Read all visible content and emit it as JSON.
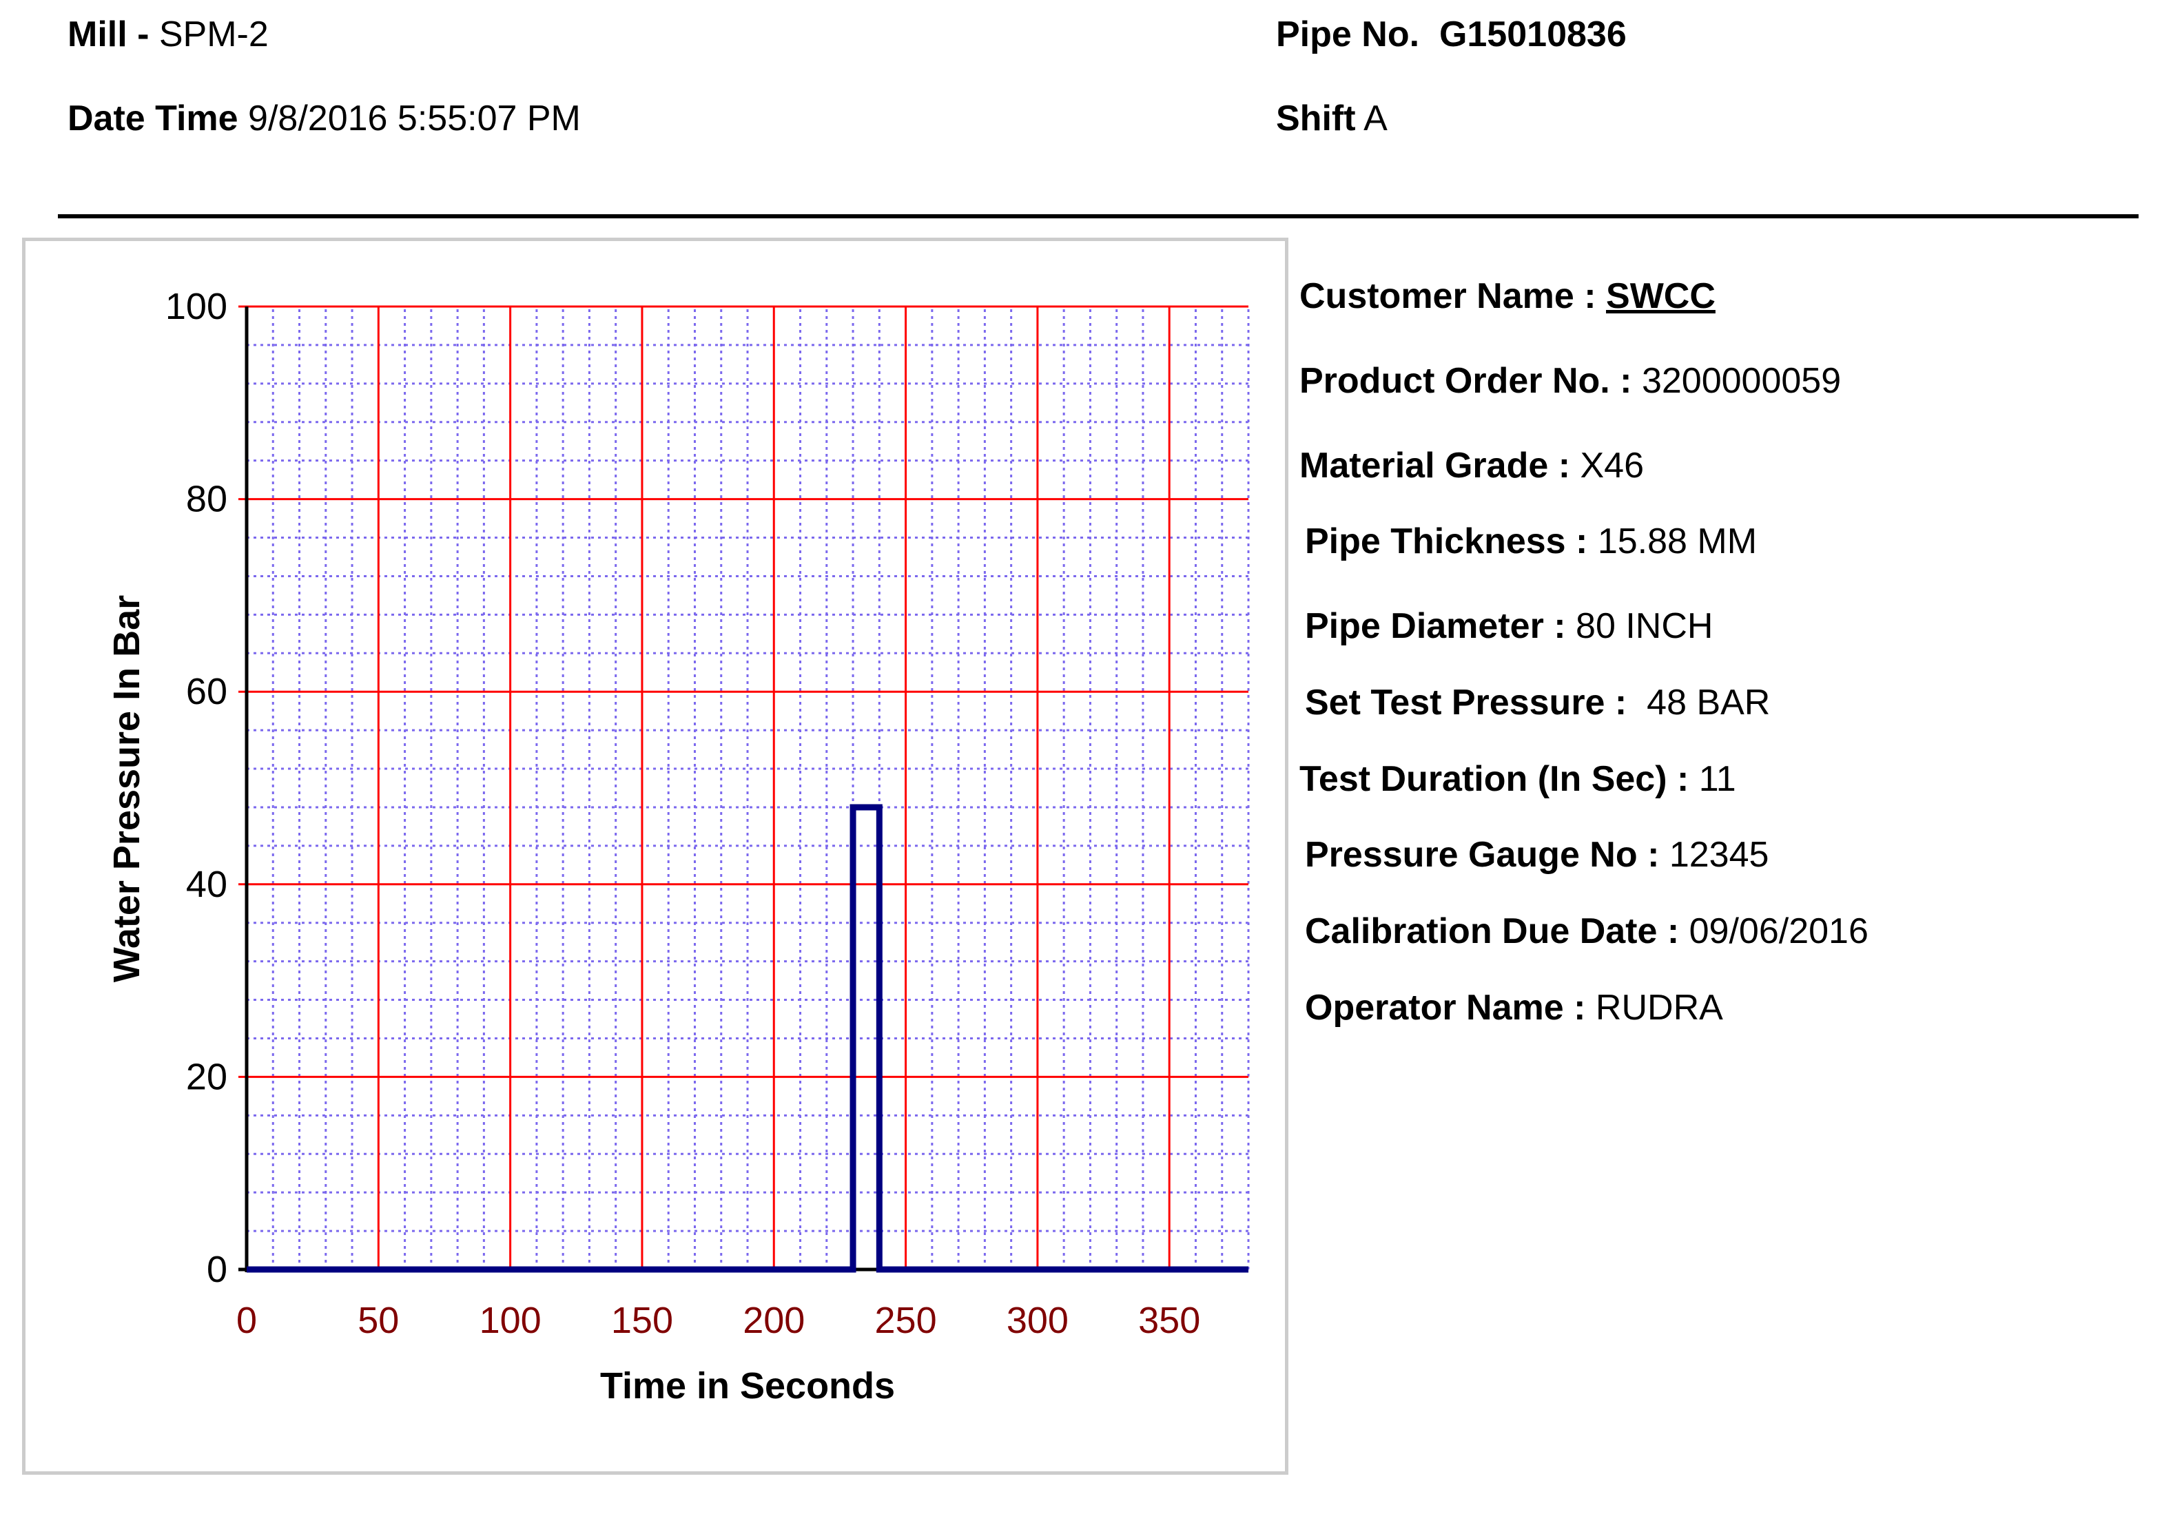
{
  "header": {
    "mill_label": "Mill -",
    "mill_value": "SPM-2",
    "datetime_label": "Date Time",
    "datetime_value": "9/8/2016 5:55:07 PM",
    "pipe_label": "Pipe No.",
    "pipe_value": "G15010836",
    "shift_label": "Shift",
    "shift_value": "A"
  },
  "info": {
    "customer_label": "Customer Name :",
    "customer_value": "SWCC",
    "order_label": "Product Order No. :",
    "order_value": "3200000059",
    "grade_label": "Material Grade :",
    "grade_value": "X46",
    "thickness_label": "Pipe Thickness :",
    "thickness_value": "15.88 MM",
    "diameter_label": "Pipe Diameter :",
    "diameter_value": "80 INCH",
    "pressure_label": "Set Test Pressure :",
    "pressure_value": "48 BAR",
    "duration_label": "Test Duration (In Sec) :",
    "duration_value": "11",
    "gauge_label": "Pressure Gauge No :",
    "gauge_value": "12345",
    "calibration_label": "Calibration Due Date :",
    "calibration_value": "09/06/2016",
    "operator_label": "Operator Name :",
    "operator_value": "RUDRA"
  },
  "chart_data": {
    "type": "line",
    "xlabel": "Time in Seconds",
    "ylabel": "Water Pressure In Bar",
    "xlim": [
      0,
      380
    ],
    "ylim": [
      0,
      100
    ],
    "x_ticks": [
      0,
      50,
      100,
      150,
      200,
      250,
      300,
      350
    ],
    "y_ticks": [
      0,
      20,
      40,
      60,
      80,
      100
    ],
    "grid": true,
    "major_grid_color": "#ff0000",
    "minor_grid_color": "#7b68ee",
    "line_color": "#000080",
    "x_tick_color": "#800000",
    "series": [
      {
        "x": [
          0,
          230,
          230,
          240,
          240,
          380
        ],
        "y": [
          0,
          0,
          48,
          48,
          0,
          0
        ]
      }
    ]
  }
}
